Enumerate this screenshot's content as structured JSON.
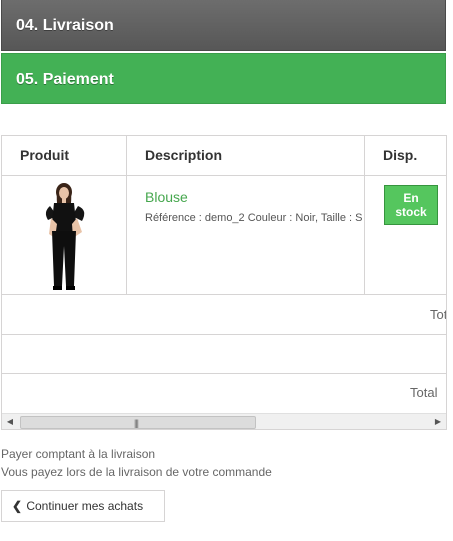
{
  "steps": [
    {
      "label": "04. Livraison"
    },
    {
      "label": "05. Paiement"
    }
  ],
  "table": {
    "headers": {
      "produit": "Produit",
      "description": "Description",
      "disp": "Disp."
    },
    "product": {
      "name": "Blouse",
      "attributes": "Référence : demo_2 Couleur : Noir, Taille : S",
      "availability_line1": "En",
      "availability_line2": "stock"
    },
    "total1_label": "Tot",
    "total2_label": "Total"
  },
  "payment": {
    "line1": "Payer comptant à la livraison",
    "line2": "Vous payez lors de la livraison de votre commande"
  },
  "continue_button": {
    "label": "Continuer mes achats"
  },
  "colors": {
    "accent_green": "#43b155",
    "link_green": "#46a74e",
    "step_gray": "#666666"
  }
}
